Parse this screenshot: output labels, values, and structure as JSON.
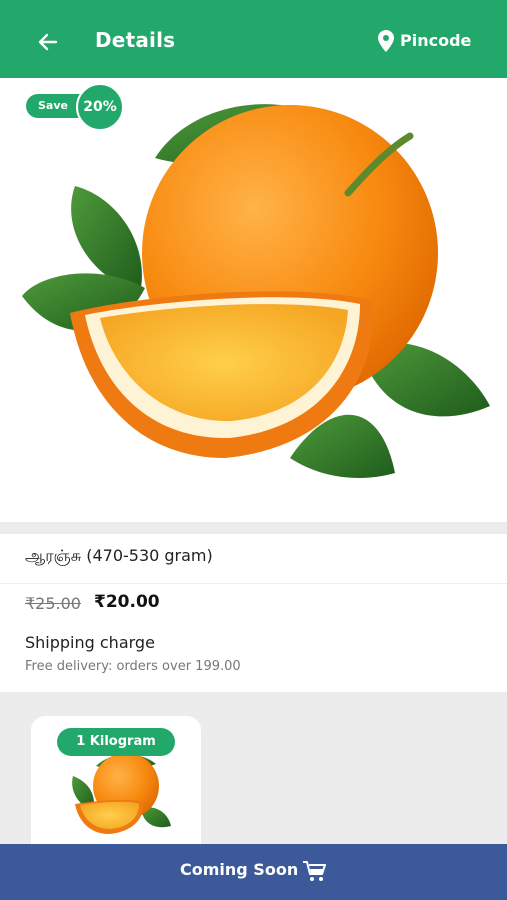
{
  "header": {
    "title": "Details",
    "location_label": "Pincode",
    "back_icon": "arrow-left-icon",
    "location_icon": "map-pin-icon",
    "bar_color": "#22a86a"
  },
  "hero": {
    "image": "orange-fruit-image",
    "save_label": "Save",
    "discount": "20%"
  },
  "product": {
    "name": "ஆரஞ்சு (470-530 gram)",
    "mrp": "₹25.00",
    "price": "₹20.00",
    "shipping_label": "Shipping charge",
    "shipping_note": "Free delivery: orders over 199.00"
  },
  "variants": [
    {
      "label": "1 Kilogram",
      "image": "orange-fruit-image"
    }
  ],
  "footer": {
    "label": "Coming Soon",
    "icon": "cart-icon",
    "bar_color": "#3c5a9a"
  }
}
